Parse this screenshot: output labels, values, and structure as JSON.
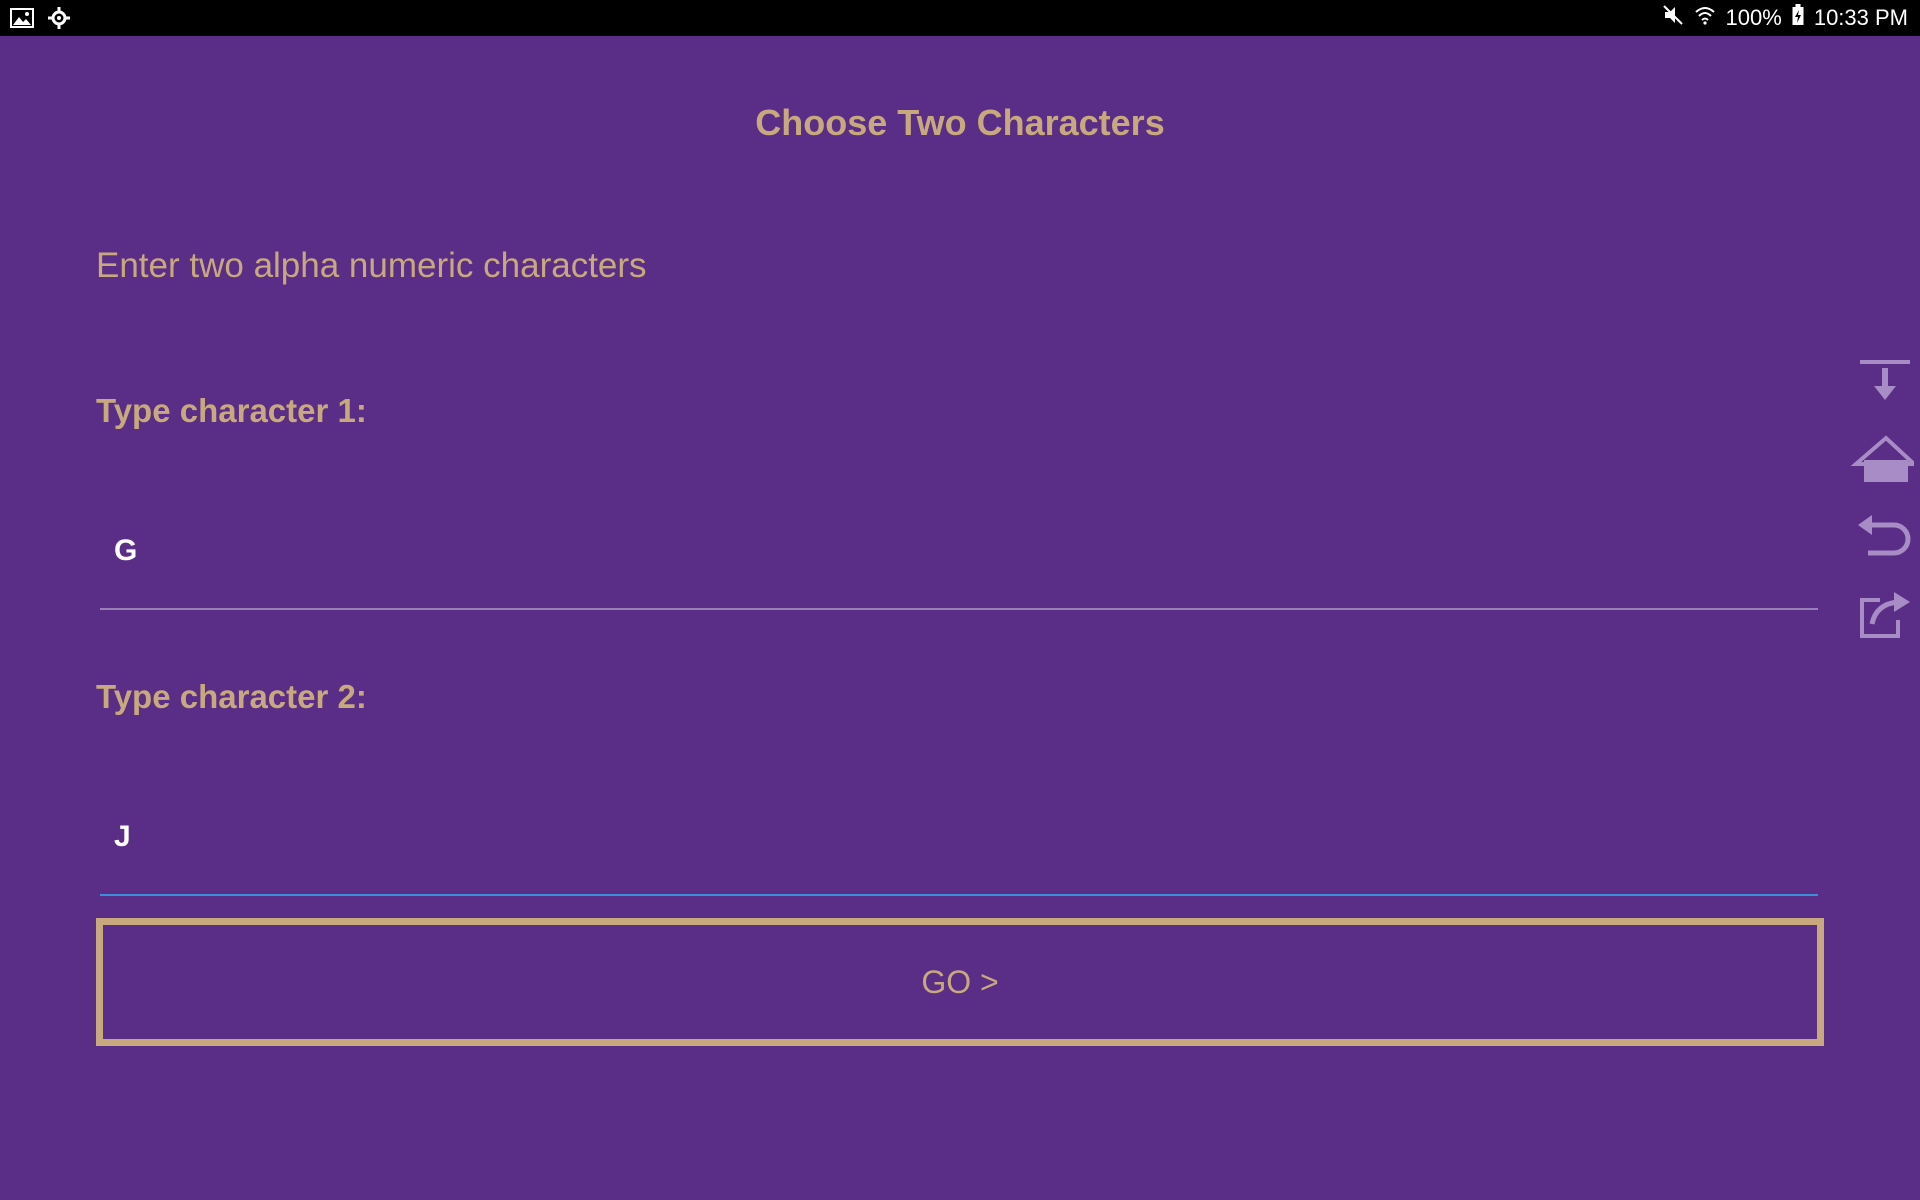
{
  "status_bar": {
    "left_icons": [
      "image-icon",
      "settings-gear-icon"
    ],
    "mute_icon": "mute-icon",
    "wifi_icon": "wifi-icon",
    "battery_text": "100%",
    "battery_icon": "battery-charging-icon",
    "time": "10:33 PM"
  },
  "page": {
    "title": "Choose Two Characters",
    "instruction": "Enter two alpha numeric characters",
    "field1": {
      "label": "Type character 1:",
      "value": "G"
    },
    "field2": {
      "label": "Type character 2:",
      "value": "J"
    },
    "go_button": "GO >"
  },
  "side_toolbar": {
    "icons": [
      "download-icon",
      "home-icon",
      "undo-icon",
      "share-icon"
    ]
  },
  "colors": {
    "background": "#5a2d86",
    "accent": "#c8a97e",
    "field_value": "#ffffff",
    "focus_underline": "#3a8fd8"
  }
}
